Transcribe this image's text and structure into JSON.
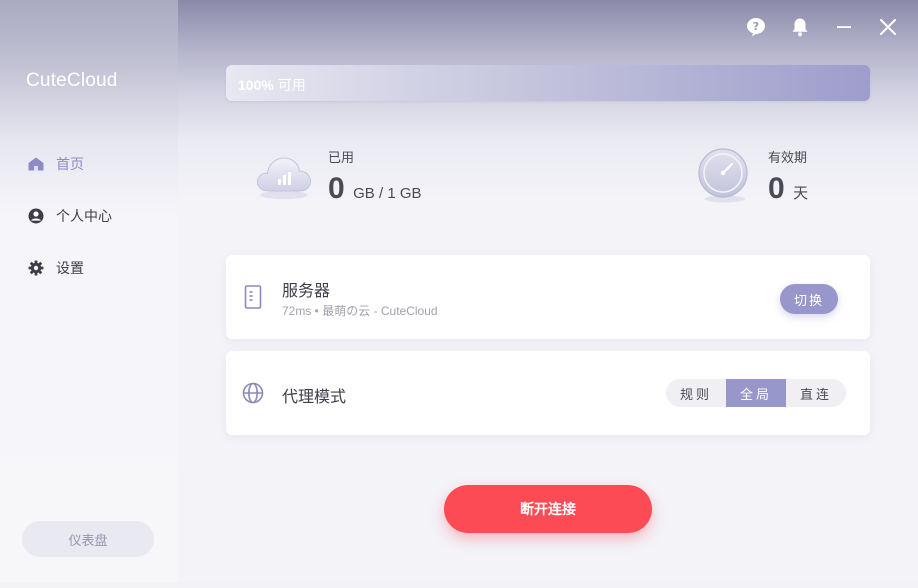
{
  "app": {
    "name": "CuteCloud"
  },
  "sidebar": {
    "items": [
      {
        "label": "首页",
        "icon": "home-icon",
        "active": true
      },
      {
        "label": "个人中心",
        "icon": "user-icon",
        "active": false
      },
      {
        "label": "设置",
        "icon": "gear-icon",
        "active": false
      }
    ],
    "dashboard_label": "仪表盘"
  },
  "window_controls": [
    "help-icon",
    "bell-icon",
    "minimize-icon",
    "close-icon"
  ],
  "quota": {
    "percent_text": "100%",
    "suffix": "可用",
    "available_fraction": 1.0
  },
  "stats": {
    "used": {
      "label": "已用",
      "value": "0",
      "unit": "GB / 1 GB"
    },
    "validity": {
      "label": "有效期",
      "value": "0",
      "unit": "天"
    }
  },
  "server": {
    "title": "服务器",
    "detail": "72ms • 最萌の云 - CuteCloud",
    "switch_label": "切换"
  },
  "proxy": {
    "title": "代理模式",
    "modes": [
      {
        "label": "规则",
        "selected": false
      },
      {
        "label": "全局",
        "selected": true
      },
      {
        "label": "直连",
        "selected": false
      }
    ]
  },
  "connection": {
    "button_label": "断开连接"
  },
  "colors": {
    "accent": "#9897cb",
    "danger": "#fd4b55",
    "active_nav": "#8d8cc4"
  }
}
